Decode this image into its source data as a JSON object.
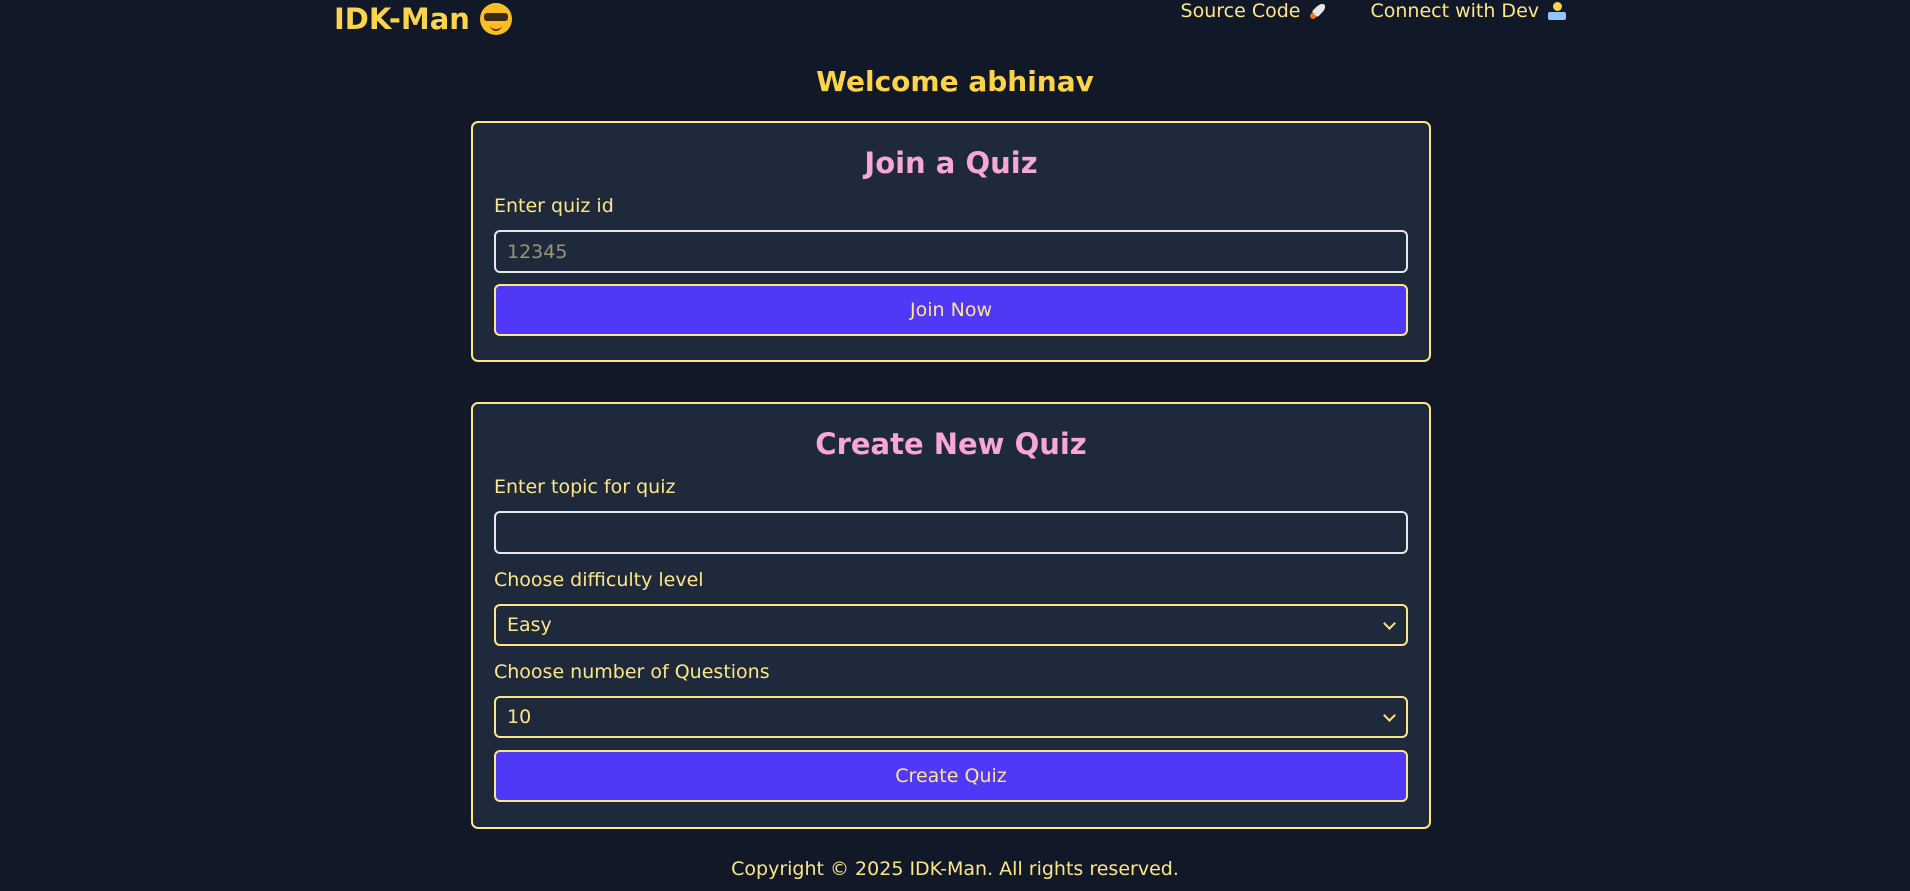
{
  "header": {
    "brand": "IDK-Man",
    "brand_icon": "smiling-face-with-sunglasses-icon",
    "nav": {
      "source_code": "Source Code",
      "source_code_icon": "rocket-icon",
      "connect": "Connect with Dev",
      "connect_icon": "technologist-laptop-icon"
    }
  },
  "welcome": "Welcome abhinav",
  "join": {
    "title": "Join a Quiz",
    "label": "Enter quiz id",
    "placeholder": "12345",
    "value": "",
    "button": "Join Now"
  },
  "create": {
    "title": "Create New Quiz",
    "topic_label": "Enter topic for quiz",
    "topic_value": "",
    "difficulty_label": "Choose difficulty level",
    "difficulty_value": "Easy",
    "questions_label": "Choose number of Questions",
    "questions_value": "10",
    "button": "Create Quiz"
  },
  "footer": "Copyright © 2025 IDK-Man. All rights reserved.",
  "colors": {
    "background": "#111827",
    "card": "#1e293b",
    "accent_yellow": "#fcd34d",
    "title_pink": "#f9a8d4",
    "button": "#4f38f6"
  }
}
